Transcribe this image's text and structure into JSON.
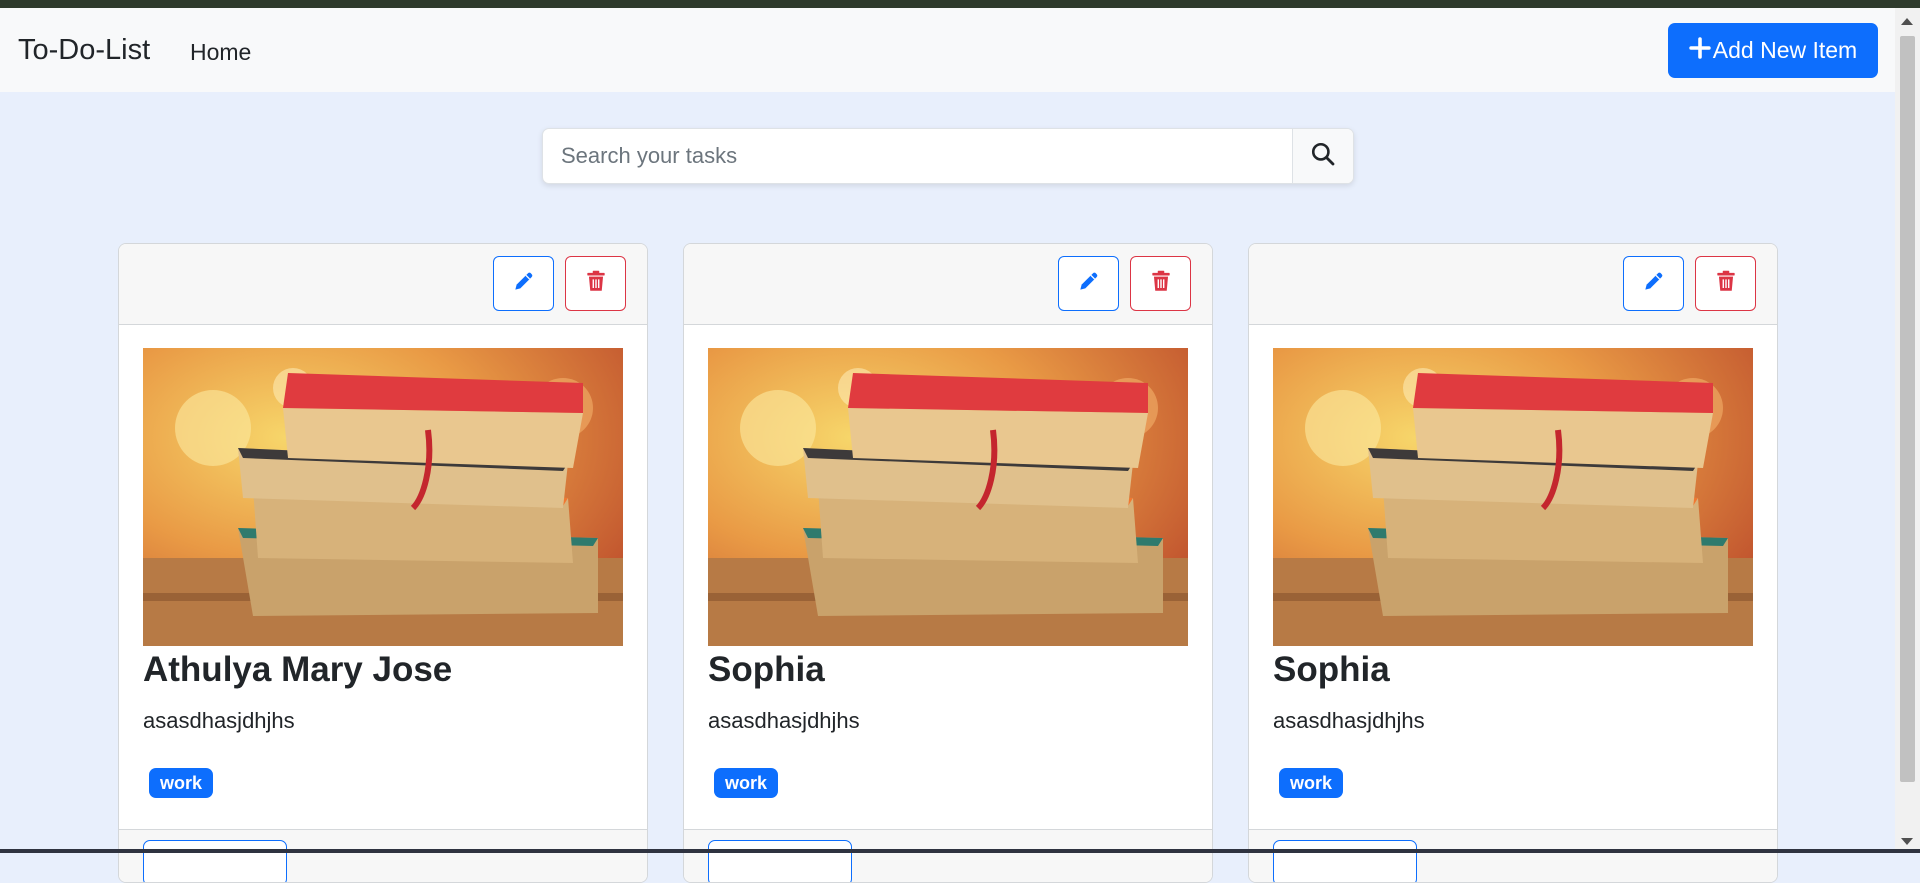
{
  "navbar": {
    "brand": "To-Do-List",
    "home_label": "Home",
    "add_button_label": "Add New Item"
  },
  "search": {
    "placeholder": "Search your tasks"
  },
  "colors": {
    "primary": "#0d6efd",
    "danger": "#dc3545",
    "page_background": "#e8effc"
  },
  "icons": {
    "add": "plus-icon",
    "search": "search-icon",
    "edit": "pencil-icon",
    "delete": "trash-icon"
  },
  "cards": [
    {
      "title": "Athulya Mary Jose",
      "description": "asasdhasjdhjhs",
      "tag": "work"
    },
    {
      "title": "Sophia",
      "description": "asasdhasjdhjhs",
      "tag": "work"
    },
    {
      "title": "Sophia",
      "description": "asasdhasjdhjhs",
      "tag": "work"
    }
  ]
}
